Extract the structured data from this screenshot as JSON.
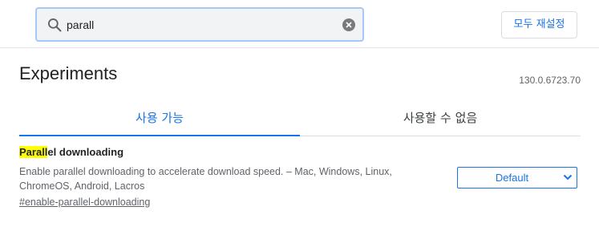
{
  "search": {
    "query": "parall",
    "icon": "search-icon",
    "clear_icon": "clear-icon"
  },
  "header": {
    "reset_label": "모두 재설정"
  },
  "page": {
    "title": "Experiments",
    "version": "130.0.6723.70"
  },
  "tabs": [
    {
      "label": "사용 가능",
      "selected": true
    },
    {
      "label": "사용할 수 없음",
      "selected": false
    }
  ],
  "experiment": {
    "name_match": "Parall",
    "name_rest": "el downloading",
    "description_line1": "Enable parallel downloading to accelerate download speed. – Mac, Windows, Linux,",
    "description_line2": "ChromeOS, Android, Lacros",
    "link": "#enable-parallel-downloading",
    "selected_option": "Default"
  },
  "colors": {
    "accent": "#1a73e8",
    "highlight": "#ffff00",
    "search_border": "#a8c7fa"
  }
}
